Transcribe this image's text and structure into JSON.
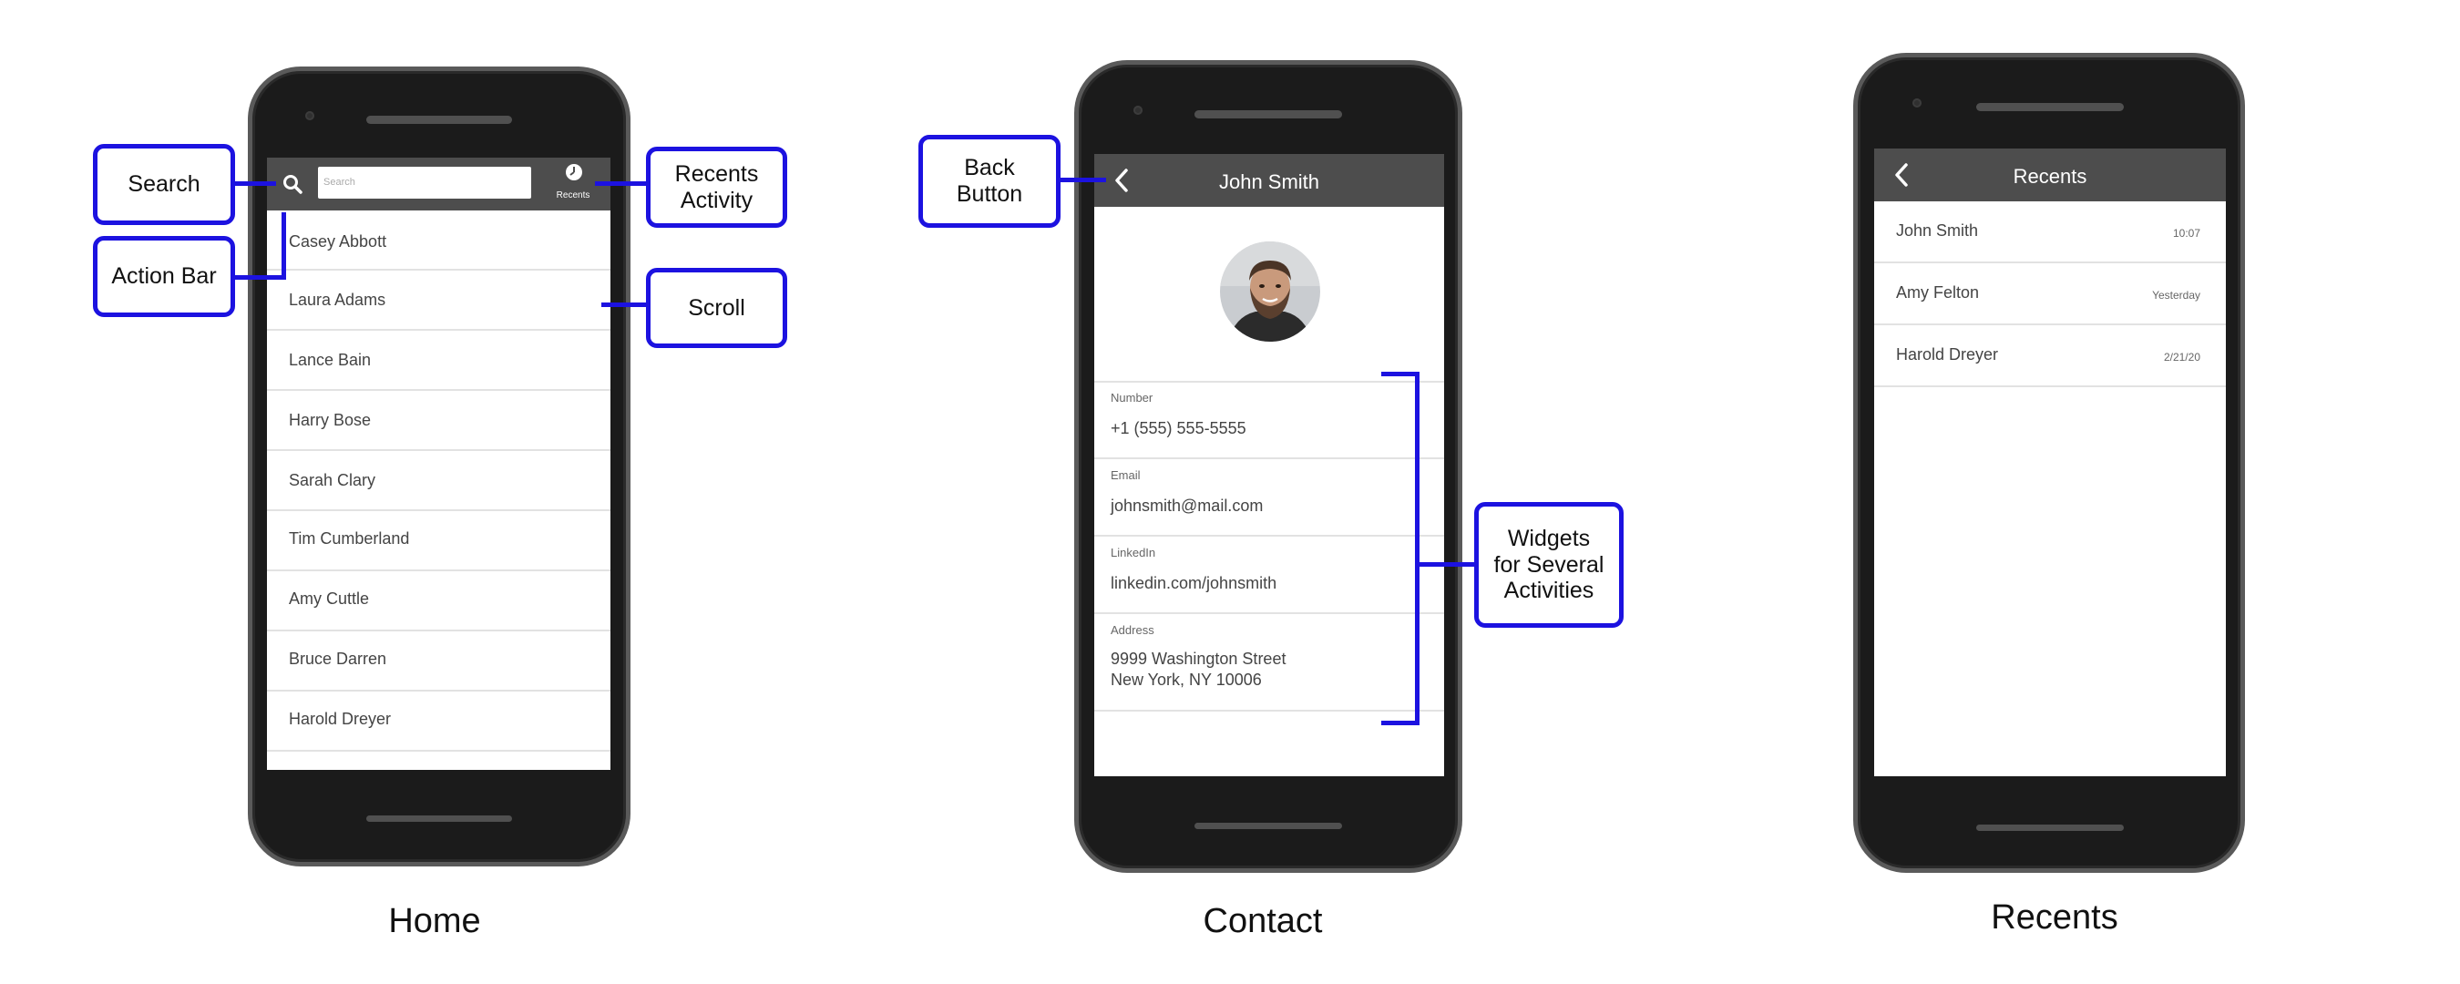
{
  "home": {
    "caption": "Home",
    "search_placeholder": "Search",
    "recents_label": "Recents",
    "contacts": [
      "Casey Abbott",
      "Laura Adams",
      "Lance Bain",
      "Harry Bose",
      "Sarah Clary",
      "Tim Cumberland",
      "Amy Cuttle",
      "Bruce Darren",
      "Harold Dreyer"
    ]
  },
  "contact": {
    "caption": "Contact",
    "title": "John Smith",
    "fields": [
      {
        "label": "Number",
        "value": "+1 (555) 555-5555"
      },
      {
        "label": "Email",
        "value": "johnsmith@mail.com"
      },
      {
        "label": "LinkedIn",
        "value": "linkedin.com/johnsmith"
      },
      {
        "label": "Address",
        "value": "9999 Washington Street\nNew York, NY 10006"
      }
    ]
  },
  "recents": {
    "caption": "Recents",
    "title": "Recents",
    "items": [
      {
        "name": "John Smith",
        "time": "10:07"
      },
      {
        "name": "Amy Felton",
        "time": "Yesterday"
      },
      {
        "name": "Harold Dreyer",
        "time": "2/21/20"
      }
    ]
  },
  "callouts": {
    "search": "Search",
    "action_bar": "Action Bar",
    "recents_activity": "Recents\nActivity",
    "scroll": "Scroll",
    "back_button": "Back\nButton",
    "widgets": "Widgets\nfor Several\nActivities"
  },
  "colors": {
    "callout_blue": "#1c12e0",
    "app_bar": "#4d4d4d",
    "phone_body": "#1b1b1b"
  },
  "icons": [
    "search-icon",
    "clock-icon",
    "back-arrow-icon",
    "person-photo"
  ]
}
